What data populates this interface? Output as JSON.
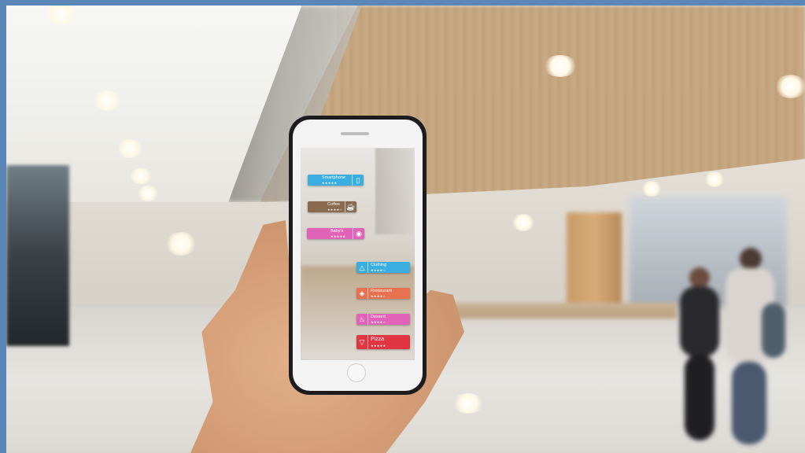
{
  "ar_tags": [
    {
      "label": "Smartphone",
      "stars": "★★★★★",
      "icon": "smartphone-icon",
      "color": "#3aaee0"
    },
    {
      "label": "Coffee",
      "stars": "★★★★☆",
      "icon": "coffee-cup-icon",
      "color": "#8a6a4e"
    },
    {
      "label": "Baby's",
      "stars": "★★★★★",
      "icon": "baby-shirt-icon",
      "color": "#e163b8"
    },
    {
      "label": "Clothing",
      "stars": "★★★★☆",
      "icon": "hanger-icon",
      "color": "#3aaee0"
    },
    {
      "label": "Restaurant",
      "stars": "★★★★☆",
      "icon": "restaurant-icon",
      "color": "#e8714f"
    },
    {
      "label": "Dessert",
      "stars": "★★★★☆",
      "icon": "cupcake-icon",
      "color": "#e163b8"
    },
    {
      "label": "Pizza",
      "stars": "★★★★★",
      "icon": "pizza-icon",
      "color": "#e23542"
    }
  ],
  "colors": {
    "frame": "#5a86b8",
    "skin": "#d49d76",
    "phone": "#1c1c1e"
  }
}
